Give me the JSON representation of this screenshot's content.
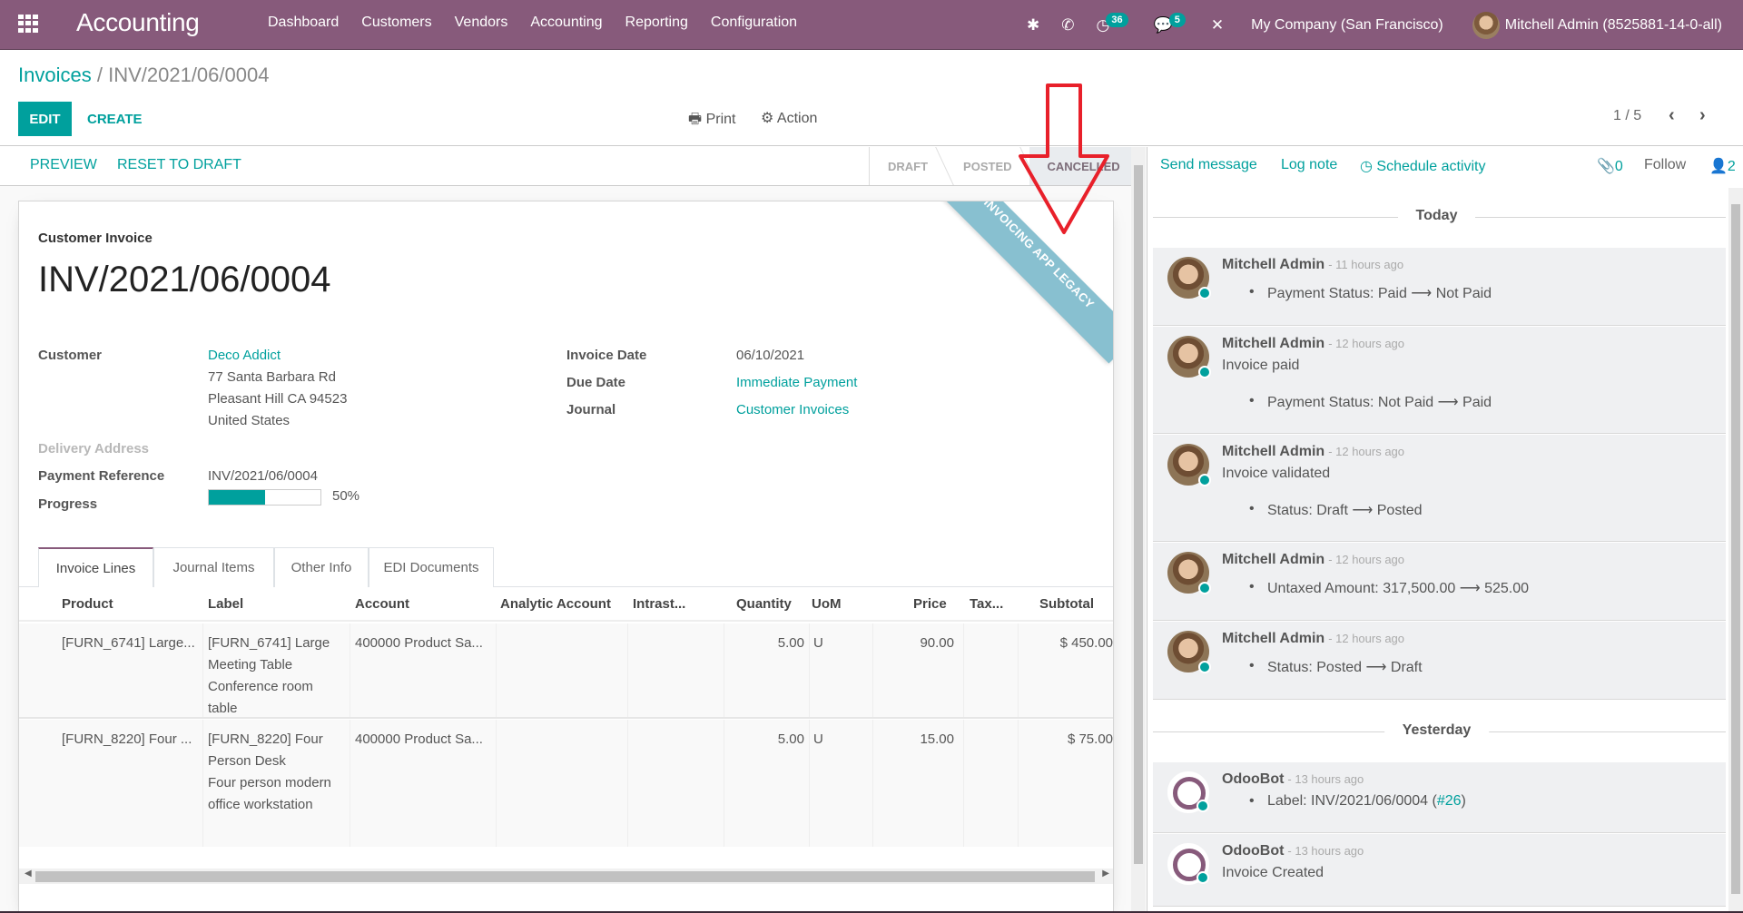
{
  "navbar": {
    "app_name": "Accounting",
    "menu": [
      "Dashboard",
      "Customers",
      "Vendors",
      "Accounting",
      "Reporting",
      "Configuration"
    ],
    "activity_count": "36",
    "message_count": "5",
    "company": "My Company (San Francisco)",
    "user": "Mitchell Admin (8525881-14-0-all)",
    "icons": {
      "apps": "apps-grid-icon",
      "debug": "bug-icon",
      "phone": "phone-icon",
      "activity": "clock-icon",
      "messages": "comments-icon",
      "tools": "wrench-icon"
    }
  },
  "control": {
    "breadcrumb_parent": "Invoices",
    "breadcrumb_sep": "/",
    "breadcrumb_current": "INV/2021/06/0004",
    "edit_label": "EDIT",
    "create_label": "CREATE",
    "print_label": "Print",
    "action_label": "Action",
    "pager": "1 / 5"
  },
  "statusbar": {
    "preview_label": "PREVIEW",
    "reset_label": "RESET TO DRAFT",
    "stages": [
      "DRAFT",
      "POSTED",
      "CANCELLED"
    ],
    "active_stage": "CANCELLED"
  },
  "invoice": {
    "ribbon": "INVOICING APP LEGACY",
    "type": "Customer Invoice",
    "name": "INV/2021/06/0004",
    "customer_label": "Customer",
    "customer_name": "Deco Addict",
    "address": [
      "77 Santa Barbara Rd",
      "Pleasant Hill CA 94523",
      "United States"
    ],
    "delivery_label": "Delivery Address",
    "payment_ref_label": "Payment Reference",
    "payment_ref": "INV/2021/06/0004",
    "progress_label": "Progress",
    "progress_value": 50,
    "progress_text": "50%",
    "invoice_date_label": "Invoice Date",
    "invoice_date": "06/10/2021",
    "due_date_label": "Due Date",
    "due_date": "Immediate Payment",
    "journal_label": "Journal",
    "journal": "Customer Invoices"
  },
  "tabs": [
    "Invoice Lines",
    "Journal Items",
    "Other Info",
    "EDI Documents"
  ],
  "lines": {
    "columns": [
      "Product",
      "Label",
      "Account",
      "Analytic Account",
      "Intrast...",
      "Quantity",
      "UoM",
      "Price",
      "Tax...",
      "Subtotal"
    ],
    "rows": [
      {
        "product": "[FURN_6741] Large...",
        "label": [
          "[FURN_6741] Large",
          "Meeting Table",
          "Conference room",
          "table"
        ],
        "account": "400000 Product Sa...",
        "quantity": "5.00",
        "uom": "U",
        "price": "90.00",
        "subtotal": "$ 450.00"
      },
      {
        "product": "[FURN_8220] Four ...",
        "label": [
          "[FURN_8220] Four",
          "Person Desk",
          "Four person modern",
          "office workstation"
        ],
        "account": "400000 Product Sa...",
        "quantity": "5.00",
        "uom": "U",
        "price": "15.00",
        "subtotal": "$ 75.00"
      }
    ]
  },
  "chatter": {
    "send_message": "Send message",
    "log_note": "Log note",
    "schedule_activity": "Schedule activity",
    "attachments": "0",
    "follow": "Follow",
    "followers": "2",
    "today": "Today",
    "yesterday": "Yesterday",
    "messages": [
      {
        "author": "Mitchell Admin",
        "time": "- 11 hours ago",
        "body": "",
        "items": [
          "Payment Status: Paid ⟶ Not Paid"
        ]
      },
      {
        "author": "Mitchell Admin",
        "time": "- 12 hours ago",
        "body": "Invoice paid",
        "items": [
          "Payment Status: Not Paid ⟶ Paid"
        ]
      },
      {
        "author": "Mitchell Admin",
        "time": "- 12 hours ago",
        "body": "Invoice validated",
        "items": [
          "Status: Draft ⟶ Posted"
        ]
      },
      {
        "author": "Mitchell Admin",
        "time": "- 12 hours ago",
        "body": "",
        "items": [
          "Untaxed Amount: 317,500.00 ⟶ 525.00"
        ]
      },
      {
        "author": "Mitchell Admin",
        "time": "- 12 hours ago",
        "body": "",
        "items": [
          "Status: Posted ⟶ Draft"
        ]
      },
      {
        "author": "OdooBot",
        "time": "- 13 hours ago",
        "body": "",
        "items": [
          "Label:  INV/2021/06/0004 ("
        ],
        "link": "#26",
        "link_tail": ")"
      },
      {
        "author": "OdooBot",
        "time": "- 13 hours ago",
        "body": "Invoice Created",
        "items": []
      }
    ]
  },
  "colors": {
    "brand": "#875a7b",
    "accent": "#00a09d",
    "ribbon": "#88c0d0",
    "annotation": "#e8202a"
  }
}
